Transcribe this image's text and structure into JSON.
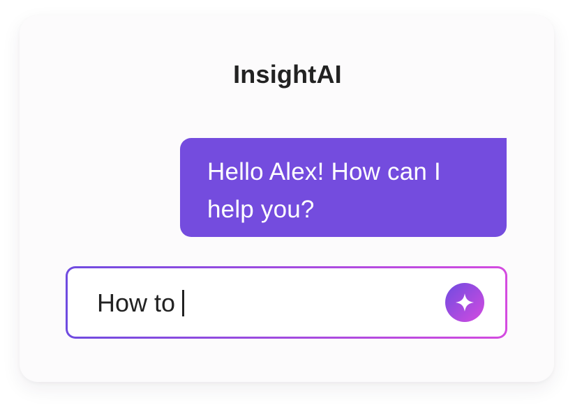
{
  "app": {
    "title": "InsightAI"
  },
  "messages": [
    {
      "role": "assistant",
      "text": "Hello Alex! How can I help you?"
    }
  ],
  "composer": {
    "value": "How to",
    "send_icon": "sparkle-icon"
  },
  "colors": {
    "bubble": "#744CDE",
    "gradient_start": "#6F4BE0",
    "gradient_end": "#D44BE0",
    "title_text": "#222222",
    "card_background": "#FCFBFC"
  }
}
